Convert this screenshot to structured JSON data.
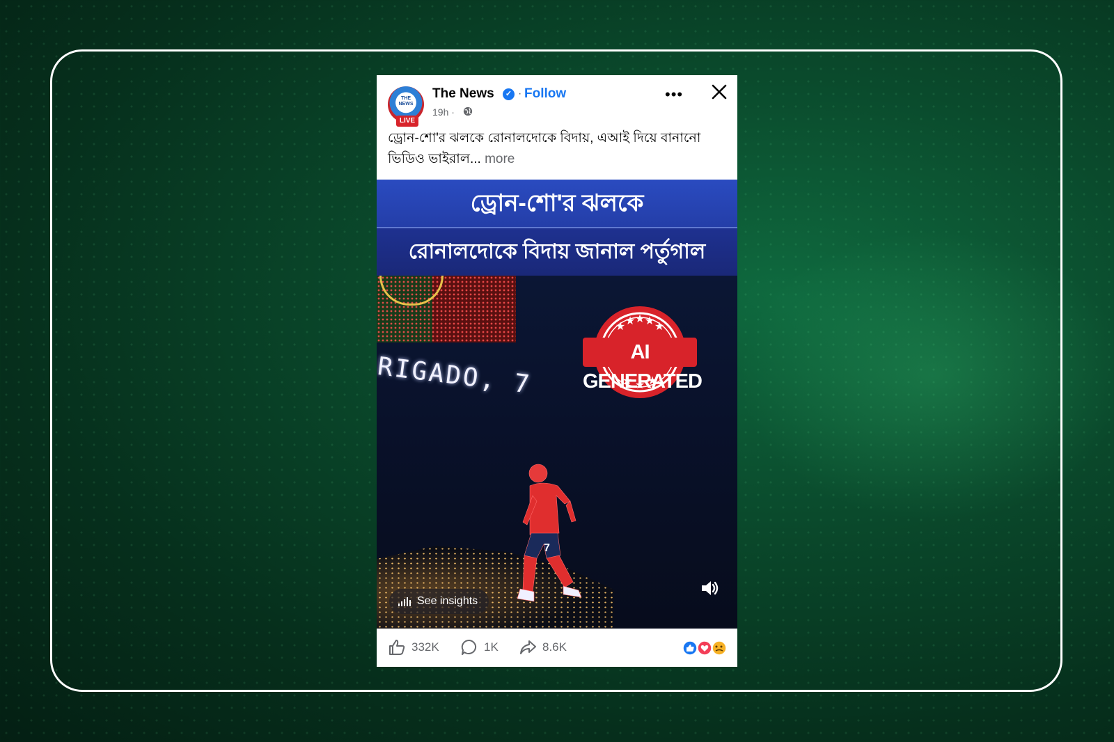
{
  "post": {
    "page_name": "The News",
    "follow_label": "Follow",
    "separator": "·",
    "time": "19h ·",
    "avatar_text": "THE NEWS",
    "live_label": "LIVE",
    "caption": "ড্রোন-শো'র ঝলকে রোনালদোকে বিদায়, এআই দিয়ে বানানো ভিডিও ভাইরাল...",
    "more_label": "more"
  },
  "video": {
    "title_line_1": "ড্রোন-শো'র ঝলকে",
    "title_line_2": "রোনালদোকে বিদায় জানাল পর্তুগাল",
    "drone_text": "RIGADO, 7",
    "stamp_label": "AI GENERATED",
    "insights_label": "See insights",
    "jersey_number": "7"
  },
  "footer": {
    "likes": "332K",
    "comments": "1K",
    "shares": "8.6K"
  },
  "colors": {
    "facebook_blue": "#1877f2",
    "stamp_red": "#d8232a",
    "background_green": "#0a4a2c"
  },
  "icons": [
    "verified-icon",
    "globe-icon",
    "more-icon",
    "close-icon",
    "insights-icon",
    "sound-icon",
    "like-icon",
    "comment-icon",
    "share-icon",
    "reactions-icon"
  ]
}
